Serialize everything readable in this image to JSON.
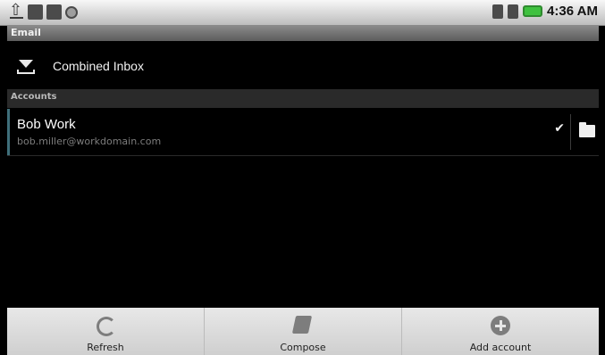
{
  "status_bar": {
    "time": "4:36 AM",
    "left_icons": [
      "upload-icon",
      "sd-card-icon",
      "gallery-icon",
      "record-icon"
    ],
    "right_icons": [
      "bluetooth-icon",
      "signal-icon",
      "battery-icon"
    ]
  },
  "title_bar": {
    "title": "Email"
  },
  "combined_inbox": {
    "label": "Combined Inbox",
    "icon": "inbox-icon"
  },
  "accounts_section": {
    "header": "Accounts"
  },
  "accounts": [
    {
      "name": "Bob Work",
      "email": "bob.miller@workdomain.com",
      "checked": true,
      "icon": "folder-icon"
    }
  ],
  "bottom_bar": {
    "buttons": [
      {
        "label": "Refresh",
        "icon": "refresh-icon"
      },
      {
        "label": "Compose",
        "icon": "compose-icon"
      },
      {
        "label": "Add account",
        "icon": "add-icon"
      }
    ]
  }
}
